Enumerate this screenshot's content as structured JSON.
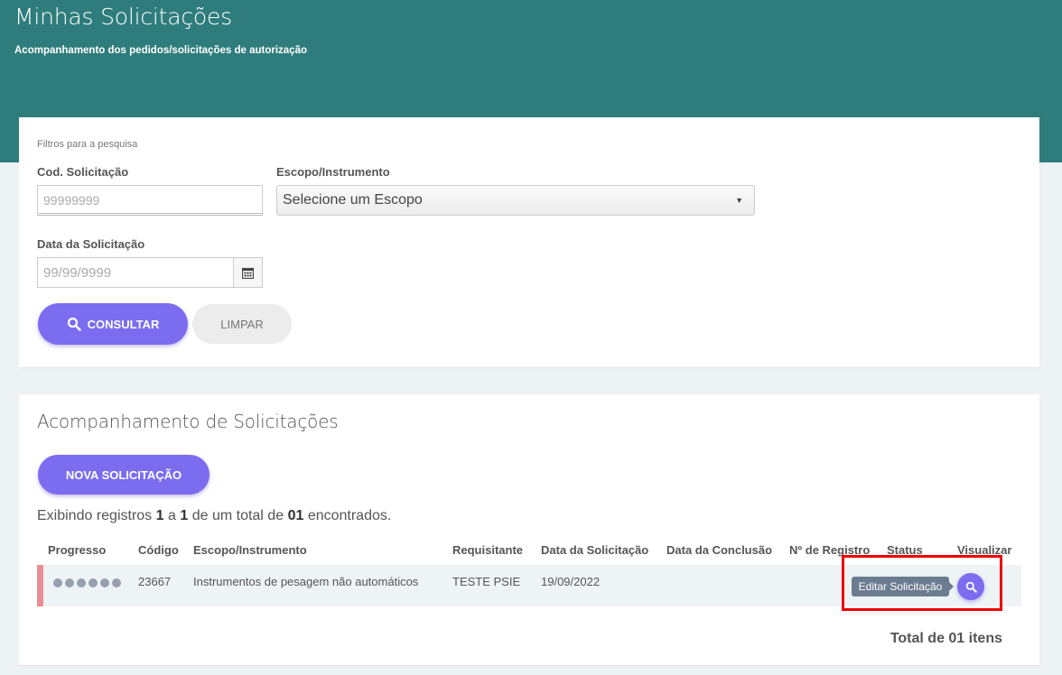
{
  "header": {
    "title": "Minhas Solicitações",
    "subtitle": "Acompanhamento dos pedidos/solicitações de autorização"
  },
  "filters": {
    "caption": "Filtros para a pesquisa",
    "cod_label": "Cod. Solicitação",
    "cod_placeholder": "99999999",
    "escopo_label": "Escopo/Instrumento",
    "escopo_selected": "Selecione um Escopo",
    "data_label": "Data da Solicitação",
    "data_placeholder": "99/99/9999",
    "consultar_label": "CONSULTAR",
    "limpar_label": "LIMPAR"
  },
  "results": {
    "title": "Acompanhamento de Solicitações",
    "nova_label": "NOVA SOLICITAÇÃO",
    "records_prefix": "Exibindo registros",
    "records_from": "1",
    "records_a": "a",
    "records_to": "1",
    "records_mid": "de um total de",
    "records_total": "01",
    "records_suffix": "encontrados.",
    "columns": [
      "Progresso",
      "Código",
      "Escopo/Instrumento",
      "Requisitante",
      "Data da Solicitação",
      "Data da Conclusão",
      "Nº de Registro",
      "Status",
      "Visualizar"
    ],
    "rows": [
      {
        "progress_steps": 6,
        "codigo": "23667",
        "escopo": "Instrumentos de pesagem não automáticos",
        "requisitante": "TESTE PSIE",
        "data_solicitacao": "19/09/2022",
        "data_conclusao": "",
        "n_registro": "",
        "status": ""
      }
    ],
    "tooltip": "Editar Solicitação",
    "total_label": "Total de 01 itens"
  },
  "colors": {
    "header_bg": "#2e7d7c",
    "primary": "#7b6cf0",
    "row_marker": "#ec8d92",
    "highlight": "#ee0000"
  },
  "icons": [
    "search-icon",
    "calendar-icon",
    "caret-down-icon"
  ]
}
